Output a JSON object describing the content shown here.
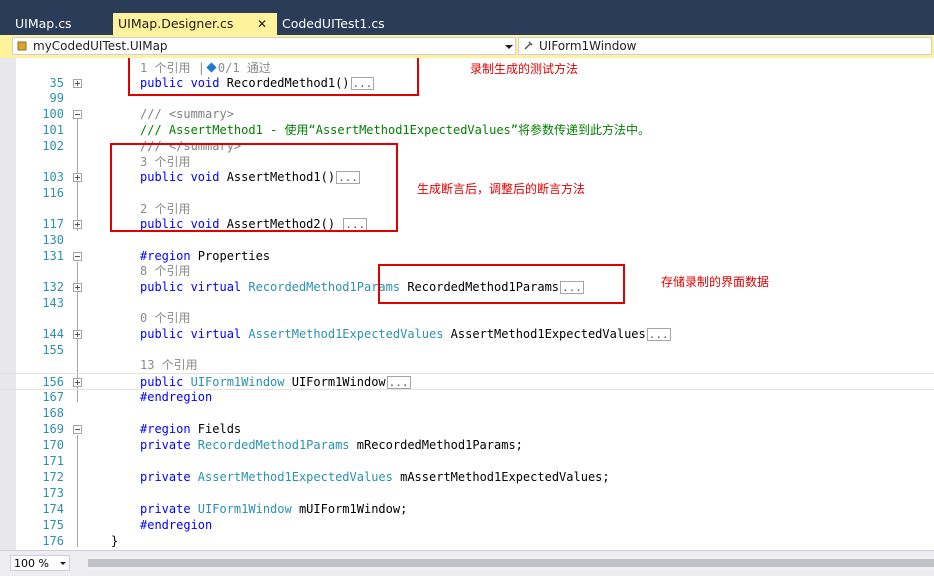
{
  "tabs": [
    {
      "label": "UIMap.cs",
      "active": false
    },
    {
      "label": "UIMap.Designer.cs",
      "active": true
    },
    {
      "label": "CodedUITest1.cs",
      "active": false
    }
  ],
  "tab_close_glyph": "✕",
  "navbar": {
    "class_dropdown": "myCodedUITest.UIMap",
    "member_dropdown": "UIForm1Window"
  },
  "code_lines": {
    "l35": {
      "num": "35",
      "kw": "public void ",
      "name": "RecordedMethod1()",
      "collapsed": "..."
    },
    "l99": {
      "num": "99"
    },
    "l100": {
      "num": "100",
      "text": "/// <summary>"
    },
    "l101": {
      "num": "101",
      "text": "/// AssertMethod1 - 使用“AssertMethod1ExpectedValues”将参数传递到此方法中。"
    },
    "l102": {
      "num": "102",
      "text": "/// </summary>"
    },
    "l103": {
      "num": "103",
      "kw": "public void ",
      "name": "AssertMethod1()",
      "collapsed": "..."
    },
    "l116": {
      "num": "116"
    },
    "l117": {
      "num": "117",
      "kw": "public void ",
      "name": "AssertMethod2() ",
      "collapsed": "..."
    },
    "l130": {
      "num": "130"
    },
    "l131": {
      "num": "131",
      "kw": "#region ",
      "name": "Properties"
    },
    "l132": {
      "num": "132",
      "kw": "public virtual ",
      "type": "RecordedMethod1Params",
      "name": " RecordedMethod1Params",
      "collapsed": "..."
    },
    "l143": {
      "num": "143"
    },
    "l144": {
      "num": "144",
      "kw": "public virtual ",
      "type": "AssertMethod1ExpectedValues",
      "name": " AssertMethod1ExpectedValues",
      "collapsed": "..."
    },
    "l155": {
      "num": "155"
    },
    "l156": {
      "num": "156",
      "kw": "public ",
      "type": "UIForm1Window",
      "name": " UIForm1Window",
      "collapsed": "..."
    },
    "l167": {
      "num": "167",
      "kw": "#endregion"
    },
    "l168": {
      "num": "168"
    },
    "l169": {
      "num": "169",
      "kw": "#region ",
      "name": "Fields"
    },
    "l170": {
      "num": "170",
      "kw": "private ",
      "type": "RecordedMethod1Params",
      "name": " mRecordedMethod1Params;"
    },
    "l171": {
      "num": "171"
    },
    "l172": {
      "num": "172",
      "kw": "private ",
      "type": "AssertMethod1ExpectedValues",
      "name": " mAssertMethod1ExpectedValues;"
    },
    "l173": {
      "num": "173"
    },
    "l174": {
      "num": "174",
      "kw": "private ",
      "type": "UIForm1Window",
      "name": " mUIForm1Window;"
    },
    "l175": {
      "num": "175",
      "kw": "#endregion"
    },
    "l176": {
      "num": "176",
      "name": "}"
    }
  },
  "codelens": {
    "c35": {
      "refs": "1 个引用",
      "sep": "|",
      "tests": "0/1 通过"
    },
    "c103": "3 个引用",
    "c117": "2 个引用",
    "c132": "8 个引用",
    "c144": "0 个引用",
    "c156": "13 个引用"
  },
  "annotations": {
    "recorded_method": "录制生成的测试方法",
    "assert_methods": "生成断言后，调整后的断言方法",
    "stored_data": "存储录制的界面数据"
  },
  "status": {
    "zoom": "100 %"
  },
  "colors": {
    "tabbar": "#2b3c59",
    "active_tab": "#fff29d",
    "keyword": "#0000ff",
    "type": "#2b91af",
    "comment": "#008000",
    "annotation": "#e00000"
  }
}
